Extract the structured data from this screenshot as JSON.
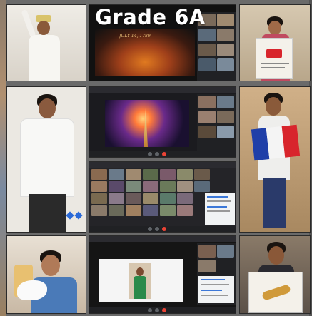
{
  "collage": {
    "title": "Grade 6A",
    "video_caption": "JULY 14, 1789"
  },
  "tiles": [
    {
      "id": "t1",
      "subject": "student-costume"
    },
    {
      "id": "t2",
      "subject": "video-call-bastille"
    },
    {
      "id": "t3",
      "subject": "student-poster"
    },
    {
      "id": "t4",
      "subject": "student-standing"
    },
    {
      "id": "t5",
      "subject": "video-call-fireworks"
    },
    {
      "id": "t6",
      "subject": "student-french-flag"
    },
    {
      "id": "t7",
      "subject": "video-call-gallery"
    },
    {
      "id": "t8",
      "subject": "student-dove"
    },
    {
      "id": "t9",
      "subject": "video-call-presentation"
    },
    {
      "id": "t10",
      "subject": "student-baguette"
    }
  ],
  "colors": {
    "flag_blue": "#1f3fa8",
    "flag_white": "#f4f4f4",
    "flag_red": "#d8252c",
    "meet_dark": "#202124",
    "end_call_red": "#ea4335"
  }
}
